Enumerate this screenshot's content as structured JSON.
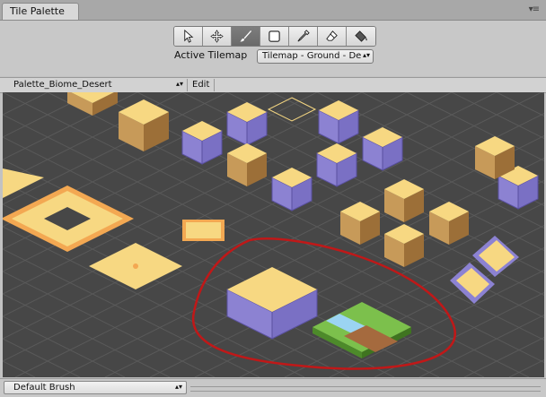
{
  "window": {
    "tab_title": "Tile Palette",
    "menu_glyph": "▾≡"
  },
  "toolbar": {
    "tools": [
      {
        "name": "select-tool",
        "icon": "arrow-cursor-icon",
        "active": false
      },
      {
        "name": "move-tool",
        "icon": "move-arrows-icon",
        "active": false
      },
      {
        "name": "paint-tool",
        "icon": "brush-icon",
        "active": true
      },
      {
        "name": "box-fill-tool",
        "icon": "rectangle-icon",
        "active": false
      },
      {
        "name": "picker-tool",
        "icon": "eyedropper-icon",
        "active": false
      },
      {
        "name": "erase-tool",
        "icon": "eraser-icon",
        "active": false
      },
      {
        "name": "fill-tool",
        "icon": "paint-bucket-icon",
        "active": false
      }
    ],
    "active_tilemap_label": "Active Tilemap",
    "active_tilemap_value": "Tilemap - Ground - De"
  },
  "palette": {
    "selected": "Palette_Biome_Desert",
    "edit_label": "Edit"
  },
  "status": {
    "brush": "Default Brush"
  },
  "colors": {
    "canvas_bg": "#474747",
    "grid_line": "#5a5a5a",
    "sand_top": "#f7d882",
    "sand_side_left": "#c79a59",
    "sand_side_right": "#9c6f38",
    "stone": "#8c82d2",
    "grass": "#7cc04c",
    "water": "#9bd4f2",
    "annotation": "#c01818"
  }
}
